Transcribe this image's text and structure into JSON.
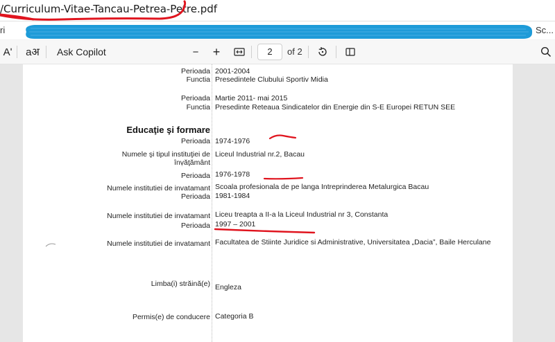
{
  "tab": {
    "title": "/Curriculum-Vitae-Tancau-Petrea-Petre.pdf"
  },
  "address": {
    "left": "ri",
    "right": "Sc..."
  },
  "toolbar": {
    "read_aloud_glyph": "Aʹ",
    "translate_glyph": "aअ",
    "ask_copilot": "Ask Copilot",
    "zoom_out": "−",
    "zoom_in": "+",
    "page_current": "2",
    "page_total": "of 2",
    "icons": [
      "read-aloud-icon",
      "translate-icon",
      "zoom-out-icon",
      "zoom-in-icon",
      "fit-page-icon",
      "rotate-icon",
      "page-view-icon",
      "search-icon"
    ]
  },
  "cv": {
    "row1": {
      "label": "Perioada",
      "value": "2001-2004"
    },
    "row2": {
      "label": "Functia",
      "value": "Presedintele Clubului Sportiv Midia"
    },
    "row3": {
      "label": "Perioada",
      "value": "Martie 2011- mai 2015"
    },
    "row4": {
      "label": "Functia",
      "value": "Presedinte Reteaua Sindicatelor din Energie din S-E Europei RETUN SEE"
    },
    "section_title": "Educaţie şi formare",
    "row5": {
      "label": "Perioada",
      "value": "1974-1976"
    },
    "row6": {
      "label_line1": "Numele şi tipul instituţiei de",
      "label_line2": "înṿăţământ",
      "value": "Liceul Industrial nr.2, Bacau"
    },
    "row7": {
      "label": "Perioada",
      "value": "1976-1978"
    },
    "row8": {
      "label": "Numele institutiei de invatamant",
      "value": "Scoala profesionala de pe langa Intreprinderea Metalurgica Bacau"
    },
    "row9": {
      "label": "Perioada",
      "value": "1981-1984"
    },
    "row10": {
      "label": "Numele institutiei de invatamant",
      "value": "Liceu treapta a II-a la Liceul Industrial nr 3, Constanta"
    },
    "row11": {
      "label": "Perioada",
      "value": "1997 – 2001"
    },
    "row12": {
      "label": "Numele institutiei de invatamant",
      "value": "Facultatea de Stiinte Juridice si Administrative, Universitatea „Dacia”, Baile Herculane"
    },
    "row13": {
      "label": "Limba(i) străină(e)",
      "value": "Engleza"
    },
    "row14": {
      "label": "Permis(e) de conducere",
      "value": "Categoria B"
    }
  },
  "colors": {
    "annotation": "#e0141e",
    "redaction": "#1e9bd8",
    "page": "#ffffff",
    "viewer_bg": "#e6e6e6"
  }
}
